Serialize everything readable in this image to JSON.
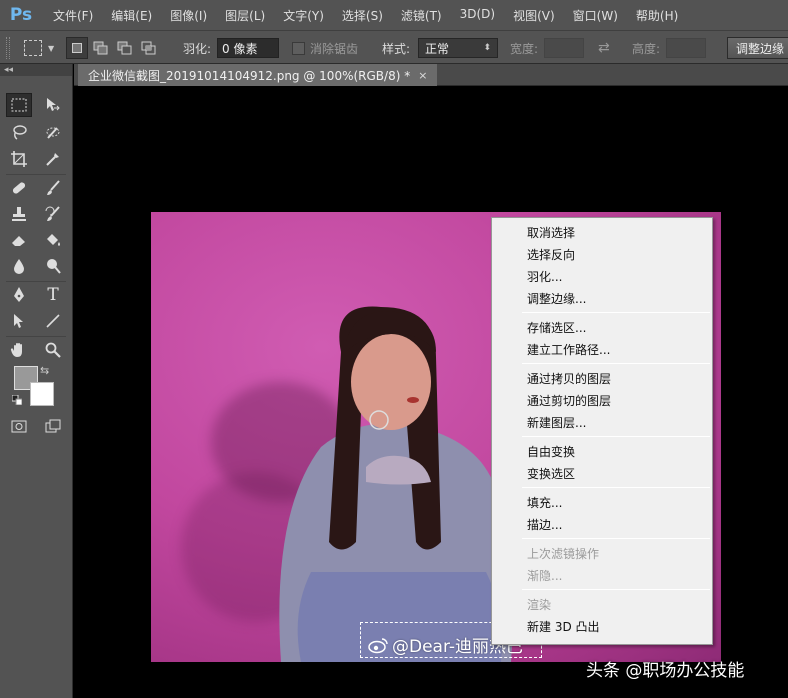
{
  "app": {
    "logo": "Ps"
  },
  "menu": [
    "文件(F)",
    "编辑(E)",
    "图像(I)",
    "图层(L)",
    "文字(Y)",
    "选择(S)",
    "滤镜(T)",
    "3D(D)",
    "视图(V)",
    "窗口(W)",
    "帮助(H)"
  ],
  "options": {
    "feather_label": "羽化:",
    "feather_value": "0 像素",
    "antialias_label": "消除锯齿",
    "style_label": "样式:",
    "style_value": "正常",
    "width_label": "宽度:",
    "height_label": "高度:",
    "refine_edge": "调整边缘"
  },
  "document": {
    "tab_title": "企业微信截图_20191014104912.png @ 100%(RGB/8) *",
    "close_glyph": "×"
  },
  "canvas": {
    "watermark_text": "@Dear-迪丽热巴"
  },
  "context_menu": {
    "groups": [
      [
        {
          "label": "取消选择",
          "enabled": true
        },
        {
          "label": "选择反向",
          "enabled": true
        },
        {
          "label": "羽化...",
          "enabled": true
        },
        {
          "label": "调整边缘...",
          "enabled": true
        }
      ],
      [
        {
          "label": "存储选区...",
          "enabled": true
        },
        {
          "label": "建立工作路径...",
          "enabled": true
        }
      ],
      [
        {
          "label": "通过拷贝的图层",
          "enabled": true
        },
        {
          "label": "通过剪切的图层",
          "enabled": true
        },
        {
          "label": "新建图层...",
          "enabled": true
        }
      ],
      [
        {
          "label": "自由变换",
          "enabled": true
        },
        {
          "label": "变换选区",
          "enabled": true
        }
      ],
      [
        {
          "label": "填充...",
          "enabled": true
        },
        {
          "label": "描边...",
          "enabled": true
        }
      ],
      [
        {
          "label": "上次滤镜操作",
          "enabled": false
        },
        {
          "label": "渐隐...",
          "enabled": false
        }
      ],
      [
        {
          "label": "渲染",
          "enabled": false
        },
        {
          "label": "新建 3D 凸出",
          "enabled": true
        }
      ]
    ]
  },
  "site_watermark": "头条 @职场办公技能",
  "colors": {
    "foreground": "#999999",
    "background": "#ffffff"
  }
}
